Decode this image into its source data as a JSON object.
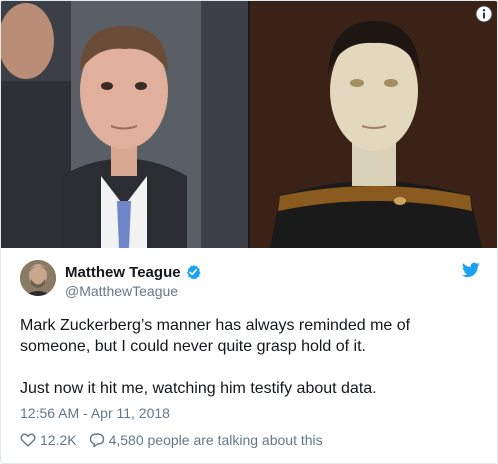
{
  "tweet": {
    "display_name": "Matthew Teague",
    "handle": "@MatthewTeague",
    "verified_icon": "verified-badge-icon",
    "paragraphs": [
      "Mark Zuckerberg’s manner has always reminded me of someone, but I could never quite grasp hold of it.",
      "Just now it hit me, watching him testify about data."
    ],
    "timestamp": "12:56 AM - Apr 11, 2018",
    "likes": "12.2K",
    "replies_text": "4,580 people are talking about this"
  },
  "colors": {
    "brand": "#1da1f2",
    "text": "#14171a",
    "secondary_text": "#657786",
    "border": "#e1e8ed"
  },
  "icons": {
    "logo": "twitter-bird-icon",
    "info": "info-icon",
    "like": "heart-icon",
    "reply": "speech-bubble-icon"
  }
}
